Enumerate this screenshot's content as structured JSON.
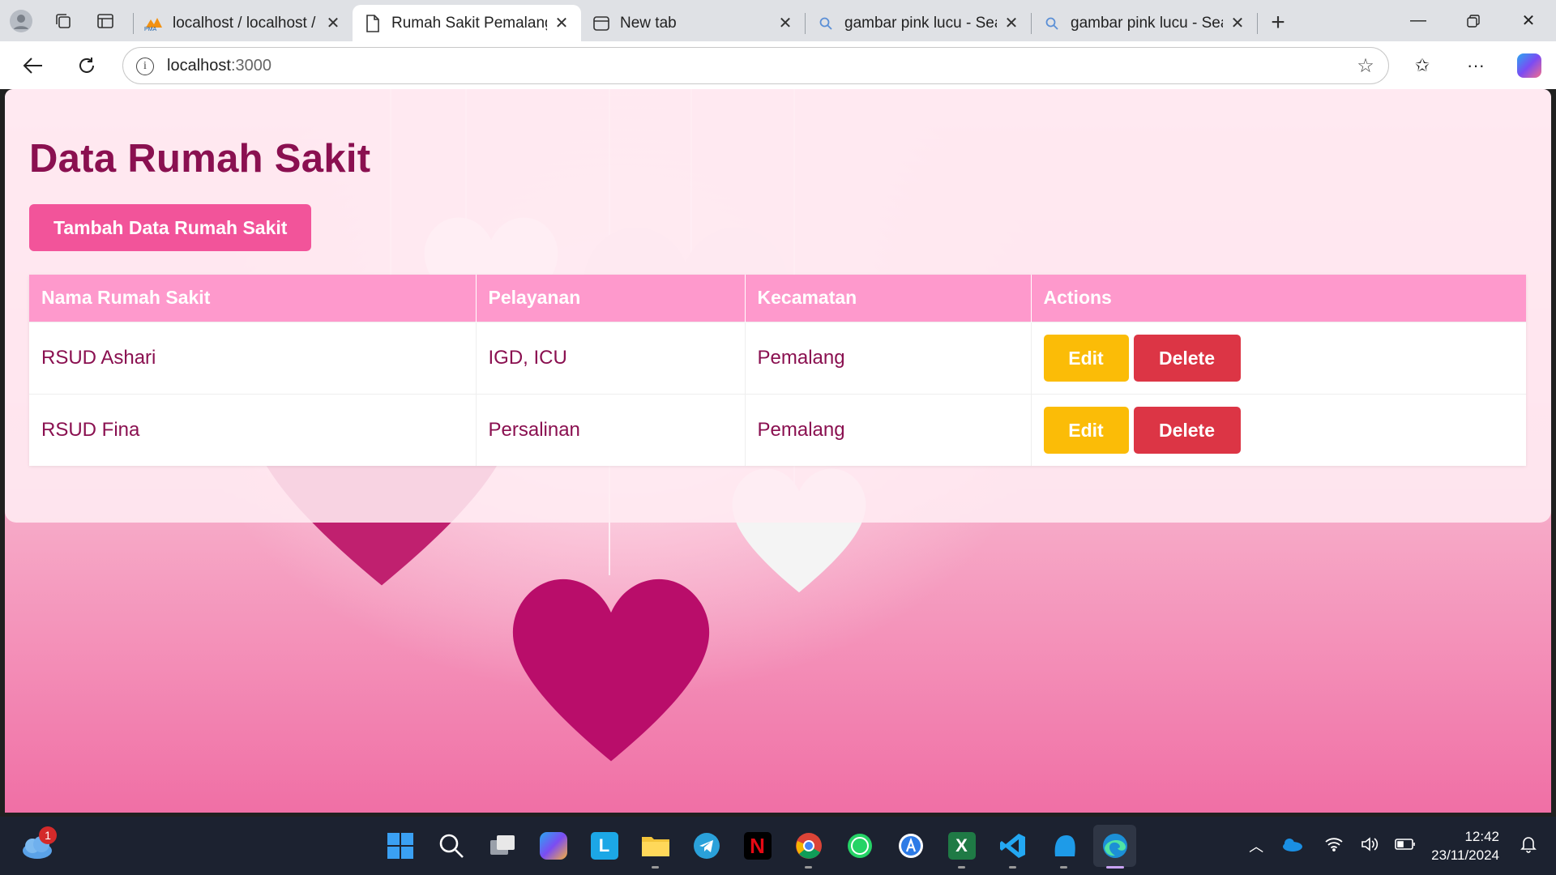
{
  "browser": {
    "tabs": [
      {
        "title": "localhost / localhost / ru",
        "favicon": "phpmyadmin-icon",
        "active": false
      },
      {
        "title": "Rumah Sakit Pemalang",
        "favicon": "document-icon",
        "active": true
      },
      {
        "title": "New tab",
        "favicon": "newtab-icon",
        "active": false
      },
      {
        "title": "gambar pink lucu - Sear",
        "favicon": "search-icon",
        "active": false
      },
      {
        "title": "gambar pink lucu - Sear",
        "favicon": "search-icon",
        "active": false
      }
    ],
    "address": {
      "host": "localhost",
      "port": ":3000"
    }
  },
  "page": {
    "title": "Data Rumah Sakit",
    "add_button": "Tambah Data Rumah Sakit",
    "table": {
      "headers": [
        "Nama Rumah Sakit",
        "Pelayanan",
        "Kecamatan",
        "Actions"
      ],
      "rows": [
        {
          "nama": "RSUD Ashari",
          "pelayanan": "IGD, ICU",
          "kecamatan": "Pemalang",
          "edit": "Edit",
          "delete": "Delete"
        },
        {
          "nama": "RSUD Fina",
          "pelayanan": "Persalinan",
          "kecamatan": "Pemalang",
          "edit": "Edit",
          "delete": "Delete"
        }
      ]
    }
  },
  "taskbar": {
    "weather_badge": "1",
    "clock": {
      "time": "12:42",
      "date": "23/11/2024"
    }
  },
  "colors": {
    "title": "#8a1050",
    "add_button": "#f2549a",
    "table_header": "#fe99cc",
    "edit": "#fbbc07",
    "delete": "#dc3545"
  }
}
